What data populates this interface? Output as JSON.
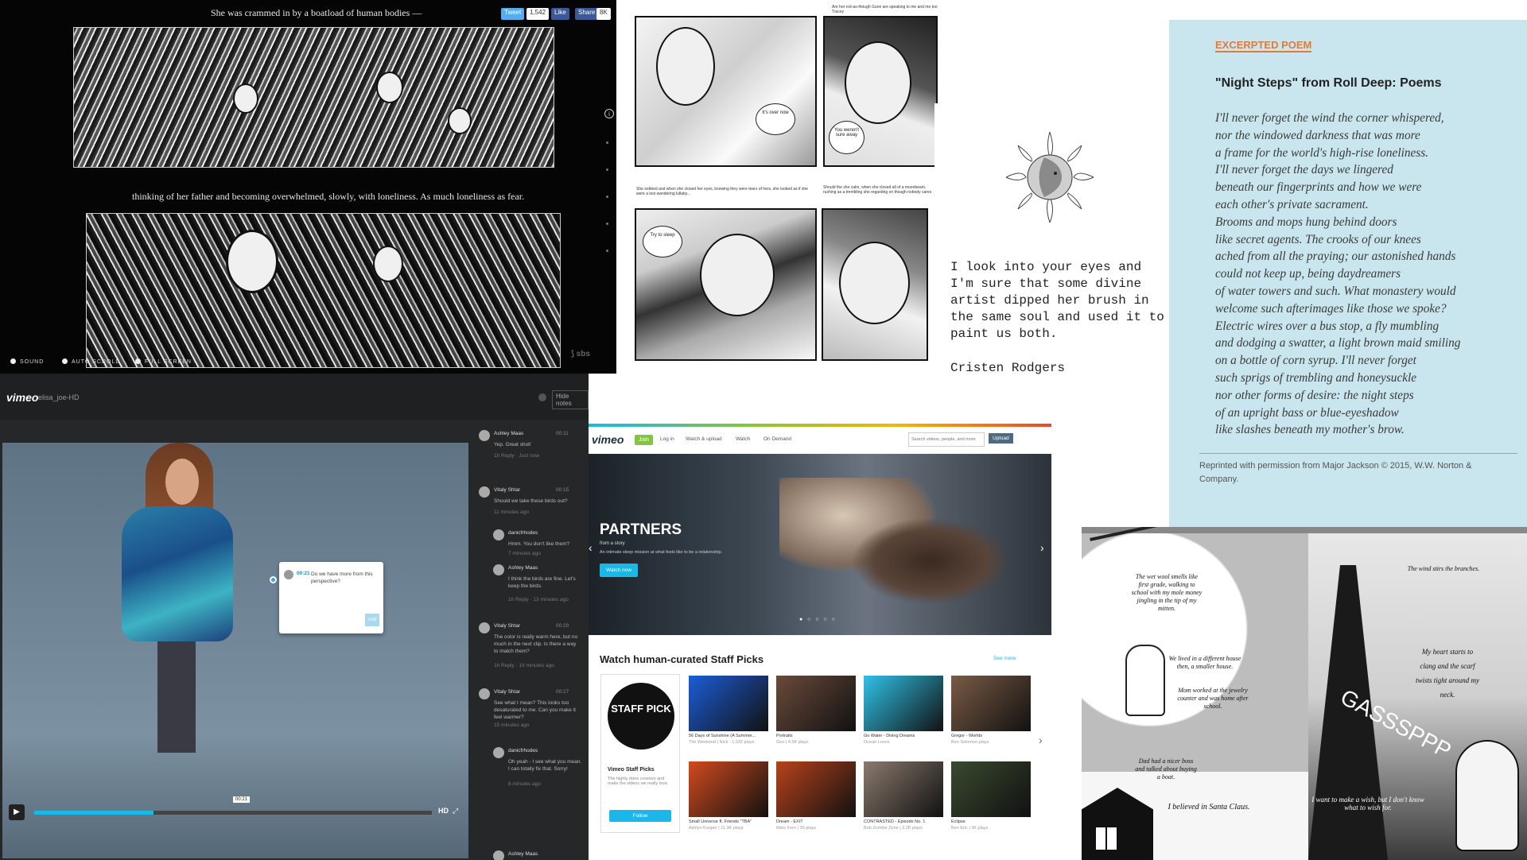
{
  "story_panel": {
    "caption_top": "She was crammed in by a boatload of human bodies —",
    "caption_mid": "thinking of her father and becoming overwhelmed, slowly, with loneliness. As much loneliness as fear.",
    "tweet_label": "Tweet",
    "tweet_count": "1,542",
    "like_label": "Like",
    "share_label": "Share",
    "share_count": "8K",
    "controls": [
      "SOUND",
      "AUTO SCROLL",
      "FULL SCREEN"
    ],
    "info_icon": "info-icon",
    "logo": "sbs-logo"
  },
  "manga_panel": {
    "caption_top": "Are her not-as-though Gunn are speaking to me and me too Tracey",
    "bubble_1": "It's over now",
    "bubble_2": "You weren't sure away",
    "caption_left": "She sobbed and when she closed her eyes, knowing they were tears of hers, she looked as if she were a lost wandering lullaby...",
    "caption_right": "Should the she calm, when she closed all of a moonbeam, rushing as a trembling she regarding on though nobody cares",
    "bubble_3": "Try to sleep"
  },
  "quote_panel": {
    "quote": "I look into your eyes and I'm sure that some divine artist dipped her brush in the same soul and used it to paint us both.",
    "author": "Cristen Rodgers",
    "sun_icon": "sun-moon-icon"
  },
  "poem_panel": {
    "tag": "EXCERPTED POEM",
    "title": "\"Night Steps\" from Roll Deep: Poems",
    "lines": [
      "I'll never forget the wind the corner whispered,",
      "nor the windowed darkness that was more",
      "a frame for the world's high-rise loneliness.",
      "I'll never forget the days we lingered",
      "beneath our fingerprints and how we were",
      "each other's private sacrament.",
      "Brooms and mops hung behind doors",
      "like secret agents. The crooks of our knees",
      "ached from all the praying; our astonished hands",
      "could not keep up, being daydreamers",
      "of water towers and such. What monastery would",
      "welcome such afterimages like those we spoke?",
      "Electric wires over a bus stop, a fly mumbling",
      "and dodging a swatter, a light brown maid smiling",
      "on a bottle of corn syrup. I'll never forget",
      "such sprigs of trembling and honeysuckle",
      "nor other forms of desire: the night steps",
      "of an upright bass or blue-eyeshadow",
      "like slashes beneath my mother's brow."
    ],
    "credit": "Reprinted with permission from Major Jackson © 2015, W.W. Norton & Company."
  },
  "vimeo_player": {
    "logo": "vimeo",
    "channel": "elisa_joe-HD",
    "hide_notes": "Hide notes",
    "tooltip_time": "00:21",
    "tooltip_text": "Do we have more from this perspective?",
    "tooltip_button": "Add",
    "scrub_time": "00:21",
    "hd_label": "HD",
    "progress": 0.3,
    "comments": [
      {
        "name": "Ashley Maas",
        "time": "00:11",
        "text": "Yep. Great shot!",
        "meta": "1h Reply · Just now"
      },
      {
        "name": "Vitaly Shtar",
        "time": "00:15",
        "text": "Should we take these birds out?",
        "meta": "11 minutes ago"
      },
      {
        "name": "danicfrhodes",
        "time": "",
        "text": "Hmm. You don't like them?",
        "meta": "7 minutes ago"
      },
      {
        "name": "Ashley Maas",
        "time": "",
        "text": "I think the birds are fine. Let's keep the birds.",
        "meta": "1h Reply · 13 minutes ago"
      },
      {
        "name": "Vitaly Shtar",
        "time": "00:20",
        "text": "The color is really warm here, but no much in the next clip. Is there a way to match them?",
        "meta": "1h Reply · 19 minutes ago"
      },
      {
        "name": "Vitaly Shtar",
        "time": "00:27",
        "text": "See what I mean? This looks too desaturated to me. Can you make it feel warmer?",
        "meta": "15 minutes ago"
      },
      {
        "name": "danicfrhodes",
        "time": "",
        "text": "Oh yeah - I see what you mean. I can totally fix that. Sorry!",
        "meta": "8 minutes ago"
      },
      {
        "name": "Ashley Maas",
        "time": "",
        "text": "",
        "meta": ""
      }
    ]
  },
  "vimeo_home": {
    "logo": "vimeo",
    "join_label": "Join",
    "nav": [
      "Log in",
      "Watch & upload",
      "Watch",
      "On Demand"
    ],
    "search_placeholder": "Search videos, people, and more",
    "upload_label": "Upload",
    "hero_title": "PARTNERS",
    "hero_subtitle": "from a story",
    "hero_desc": "An intimate sleep mission at what feels like to be a relationship.",
    "hero_button": "Watch now",
    "section_title": "Watch human-curated Staff Picks",
    "see_all": "See more",
    "staff_pick_badge": "STAFF PICK",
    "staff_pick_title": "Vimeo Staff Picks",
    "staff_pick_desc": "The highly done creators and make the videos we really love.",
    "follow_label": "Follow",
    "thumbs": [
      {
        "title": "56 Days of Sunshine (A Summer...",
        "meta": "The Weekend | Nick - 1,032 plays",
        "color": "#1c5dd8"
      },
      {
        "title": "Portraits",
        "meta": "Geo | 4.5K plays",
        "color": "#6a4a3a"
      },
      {
        "title": "Go Water - Diving Dreams",
        "meta": "Ocean Loves",
        "color": "#2fc2e8"
      },
      {
        "title": "Gregor - Worlds",
        "meta": "Ben Solomon plays",
        "color": "#7a5b45"
      },
      {
        "title": "Small Universe ft. Friends \"TBA\"",
        "meta": "Ashlyn Kooper | 11.3K plays",
        "color": "#d24a1e"
      },
      {
        "title": "Dream - EXIT",
        "meta": "Marc Fern | 39 plays",
        "color": "#b8421b"
      },
      {
        "title": "CONTRASTED - Episode No. 1",
        "meta": "Bob Zombie Zone | 2.2K plays",
        "color": "#8a7a6e"
      },
      {
        "title": "Eclipse",
        "meta": "Ben Eric | 3K plays",
        "color": "#3a4a2e"
      }
    ]
  },
  "graphic_novel": {
    "caption_1": "The wet wool smells like first grade, walking to school with my mole money jingling in the tip of my mitten.",
    "caption_2": "We lived in a different house then, a smaller house.",
    "caption_3": "Mom worked at the jewelry counter and was home after school.",
    "caption_4": "Dad had a nicer boss and talked about buying a boat.",
    "caption_5": "I believed in Santa Claus.",
    "caption_6": "The wind stirs the branches.",
    "caption_7": "My heart starts to clang and the scarf twists tight around my neck.",
    "sfx": "GASSSPPP",
    "caption_8": "I want to make a wish, but I don't know what to wish for."
  }
}
